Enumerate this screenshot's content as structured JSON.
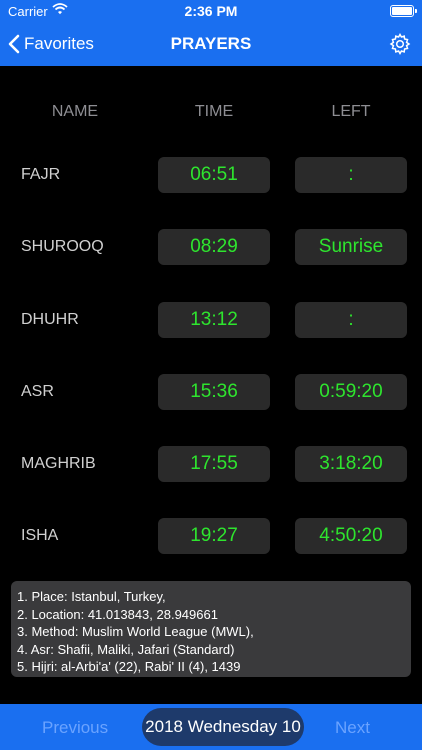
{
  "status_bar": {
    "carrier": "Carrier",
    "time": "2:36 PM"
  },
  "nav": {
    "back_label": "Favorites",
    "title": "PRAYERS",
    "settings_icon": "gear-icon"
  },
  "columns": {
    "name": "NAME",
    "time": "TIME",
    "left": "LEFT"
  },
  "prayers": [
    {
      "name": "FAJR",
      "time": "06:51",
      "left": ":"
    },
    {
      "name": "SHUROOQ",
      "time": "08:29",
      "left": "Sunrise"
    },
    {
      "name": "DHUHR",
      "time": "13:12",
      "left": ":"
    },
    {
      "name": "ASR",
      "time": "15:36",
      "left": "0:59:20"
    },
    {
      "name": "MAGHRIB",
      "time": "17:55",
      "left": "3:18:20"
    },
    {
      "name": "ISHA",
      "time": "19:27",
      "left": "4:50:20"
    }
  ],
  "info_lines": [
    "1. Place: Istanbul, Turkey,",
    "2. Location: 41.013843, 28.949661",
    "3. Method: Muslim World League (MWL),",
    "4. Asr: Shafii, Maliki, Jafari (Standard)",
    "5. Hijri: al-Arbi'a' (22), Rabi' II (4), 1439"
  ],
  "bottom": {
    "previous_label": "Previous",
    "date_label": "2018 Wednesday 10",
    "next_label": "Next"
  },
  "colors": {
    "accent": "#1a6ff0",
    "time_text": "#2ee52e",
    "cell_bg": "#2a2a2a",
    "background": "#000000"
  }
}
